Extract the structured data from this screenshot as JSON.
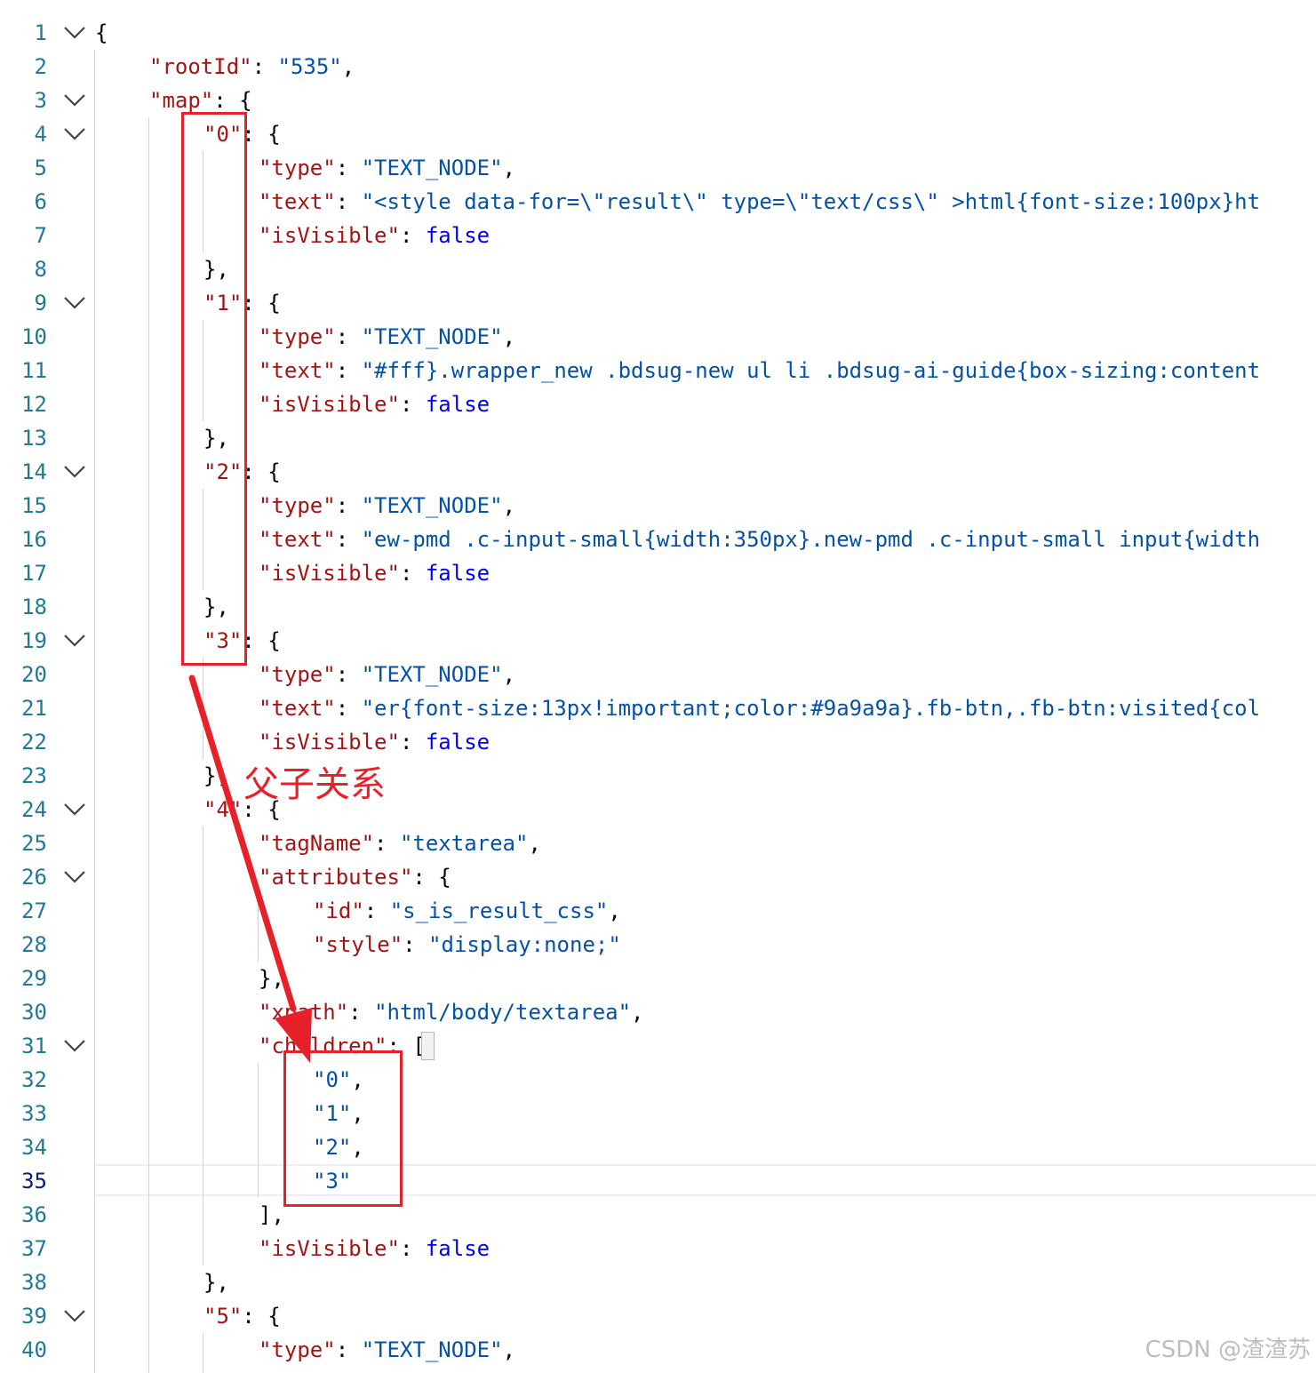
{
  "editor": {
    "active_line": 35,
    "lines": [
      {
        "n": "1",
        "fold": true,
        "indent": 0,
        "tokens": [
          [
            "p",
            "{"
          ]
        ]
      },
      {
        "n": "2",
        "fold": false,
        "indent": 1,
        "tokens": [
          [
            "k",
            "\"rootId\""
          ],
          [
            "p",
            ": "
          ],
          [
            "s",
            "\"535\""
          ],
          [
            "p",
            ","
          ]
        ]
      },
      {
        "n": "3",
        "fold": true,
        "indent": 1,
        "tokens": [
          [
            "k",
            "\"map\""
          ],
          [
            "p",
            ": {"
          ]
        ]
      },
      {
        "n": "4",
        "fold": true,
        "indent": 2,
        "tokens": [
          [
            "k",
            "\"0\""
          ],
          [
            "p",
            ": {"
          ]
        ]
      },
      {
        "n": "5",
        "fold": false,
        "indent": 3,
        "tokens": [
          [
            "k",
            "\"type\""
          ],
          [
            "p",
            ": "
          ],
          [
            "s",
            "\"TEXT_NODE\""
          ],
          [
            "p",
            ","
          ]
        ]
      },
      {
        "n": "6",
        "fold": false,
        "indent": 3,
        "tokens": [
          [
            "k",
            "\"text\""
          ],
          [
            "p",
            ": "
          ],
          [
            "s",
            "\"<style data-for=\\\"result\\\" type=\\\"text/css\\\" >html{font-size:100px}ht"
          ]
        ]
      },
      {
        "n": "7",
        "fold": false,
        "indent": 3,
        "tokens": [
          [
            "k",
            "\"isVisible\""
          ],
          [
            "p",
            ": "
          ],
          [
            "b",
            "false"
          ]
        ]
      },
      {
        "n": "8",
        "fold": false,
        "indent": 2,
        "tokens": [
          [
            "p",
            "},"
          ]
        ]
      },
      {
        "n": "9",
        "fold": true,
        "indent": 2,
        "tokens": [
          [
            "k",
            "\"1\""
          ],
          [
            "p",
            ": {"
          ]
        ]
      },
      {
        "n": "10",
        "fold": false,
        "indent": 3,
        "tokens": [
          [
            "k",
            "\"type\""
          ],
          [
            "p",
            ": "
          ],
          [
            "s",
            "\"TEXT_NODE\""
          ],
          [
            "p",
            ","
          ]
        ]
      },
      {
        "n": "11",
        "fold": false,
        "indent": 3,
        "tokens": [
          [
            "k",
            "\"text\""
          ],
          [
            "p",
            ": "
          ],
          [
            "s",
            "\"#fff}.wrapper_new .bdsug-new ul li .bdsug-ai-guide{box-sizing:content"
          ]
        ]
      },
      {
        "n": "12",
        "fold": false,
        "indent": 3,
        "tokens": [
          [
            "k",
            "\"isVisible\""
          ],
          [
            "p",
            ": "
          ],
          [
            "b",
            "false"
          ]
        ]
      },
      {
        "n": "13",
        "fold": false,
        "indent": 2,
        "tokens": [
          [
            "p",
            "},"
          ]
        ]
      },
      {
        "n": "14",
        "fold": true,
        "indent": 2,
        "tokens": [
          [
            "k",
            "\"2\""
          ],
          [
            "p",
            ": {"
          ]
        ]
      },
      {
        "n": "15",
        "fold": false,
        "indent": 3,
        "tokens": [
          [
            "k",
            "\"type\""
          ],
          [
            "p",
            ": "
          ],
          [
            "s",
            "\"TEXT_NODE\""
          ],
          [
            "p",
            ","
          ]
        ]
      },
      {
        "n": "16",
        "fold": false,
        "indent": 3,
        "tokens": [
          [
            "k",
            "\"text\""
          ],
          [
            "p",
            ": "
          ],
          [
            "s",
            "\"ew-pmd .c-input-small{width:350px}.new-pmd .c-input-small input{width"
          ]
        ]
      },
      {
        "n": "17",
        "fold": false,
        "indent": 3,
        "tokens": [
          [
            "k",
            "\"isVisible\""
          ],
          [
            "p",
            ": "
          ],
          [
            "b",
            "false"
          ]
        ]
      },
      {
        "n": "18",
        "fold": false,
        "indent": 2,
        "tokens": [
          [
            "p",
            "},"
          ]
        ]
      },
      {
        "n": "19",
        "fold": true,
        "indent": 2,
        "tokens": [
          [
            "k",
            "\"3\""
          ],
          [
            "p",
            ": {"
          ]
        ]
      },
      {
        "n": "20",
        "fold": false,
        "indent": 3,
        "tokens": [
          [
            "k",
            "\"type\""
          ],
          [
            "p",
            ": "
          ],
          [
            "s",
            "\"TEXT_NODE\""
          ],
          [
            "p",
            ","
          ]
        ]
      },
      {
        "n": "21",
        "fold": false,
        "indent": 3,
        "tokens": [
          [
            "k",
            "\"text\""
          ],
          [
            "p",
            ": "
          ],
          [
            "s",
            "\"er{font-size:13px!important;color:#9a9a9a}.fb-btn,.fb-btn:visited{col"
          ]
        ]
      },
      {
        "n": "22",
        "fold": false,
        "indent": 3,
        "tokens": [
          [
            "k",
            "\"isVisible\""
          ],
          [
            "p",
            ": "
          ],
          [
            "b",
            "false"
          ]
        ]
      },
      {
        "n": "23",
        "fold": false,
        "indent": 2,
        "tokens": [
          [
            "p",
            "},"
          ]
        ]
      },
      {
        "n": "24",
        "fold": true,
        "indent": 2,
        "tokens": [
          [
            "k",
            "\"4\""
          ],
          [
            "p",
            ": {"
          ]
        ]
      },
      {
        "n": "25",
        "fold": false,
        "indent": 3,
        "tokens": [
          [
            "k",
            "\"tagName\""
          ],
          [
            "p",
            ": "
          ],
          [
            "s",
            "\"textarea\""
          ],
          [
            "p",
            ","
          ]
        ]
      },
      {
        "n": "26",
        "fold": true,
        "indent": 3,
        "tokens": [
          [
            "k",
            "\"attributes\""
          ],
          [
            "p",
            ": {"
          ]
        ]
      },
      {
        "n": "27",
        "fold": false,
        "indent": 4,
        "tokens": [
          [
            "k",
            "\"id\""
          ],
          [
            "p",
            ": "
          ],
          [
            "s",
            "\"s_is_result_css\""
          ],
          [
            "p",
            ","
          ]
        ]
      },
      {
        "n": "28",
        "fold": false,
        "indent": 4,
        "tokens": [
          [
            "k",
            "\"style\""
          ],
          [
            "p",
            ": "
          ],
          [
            "s",
            "\"display:none;\""
          ]
        ]
      },
      {
        "n": "29",
        "fold": false,
        "indent": 3,
        "tokens": [
          [
            "p",
            "},"
          ]
        ]
      },
      {
        "n": "30",
        "fold": false,
        "indent": 3,
        "tokens": [
          [
            "k",
            "\"xpath\""
          ],
          [
            "p",
            ": "
          ],
          [
            "s",
            "\"html/body/textarea\""
          ],
          [
            "p",
            ","
          ]
        ]
      },
      {
        "n": "31",
        "fold": true,
        "indent": 3,
        "tokens": [
          [
            "k",
            "\"children\""
          ],
          [
            "p",
            ": ["
          ]
        ]
      },
      {
        "n": "32",
        "fold": false,
        "indent": 4,
        "tokens": [
          [
            "s",
            "\"0\""
          ],
          [
            "p",
            ","
          ]
        ]
      },
      {
        "n": "33",
        "fold": false,
        "indent": 4,
        "tokens": [
          [
            "s",
            "\"1\""
          ],
          [
            "p",
            ","
          ]
        ]
      },
      {
        "n": "34",
        "fold": false,
        "indent": 4,
        "tokens": [
          [
            "s",
            "\"2\""
          ],
          [
            "p",
            ","
          ]
        ]
      },
      {
        "n": "35",
        "fold": false,
        "indent": 4,
        "tokens": [
          [
            "s",
            "\"3\""
          ]
        ]
      },
      {
        "n": "36",
        "fold": false,
        "indent": 3,
        "tokens": [
          [
            "p",
            "],"
          ]
        ]
      },
      {
        "n": "37",
        "fold": false,
        "indent": 3,
        "tokens": [
          [
            "k",
            "\"isVisible\""
          ],
          [
            "p",
            ": "
          ],
          [
            "b",
            "false"
          ]
        ]
      },
      {
        "n": "38",
        "fold": false,
        "indent": 2,
        "tokens": [
          [
            "p",
            "},"
          ]
        ]
      },
      {
        "n": "39",
        "fold": true,
        "indent": 2,
        "tokens": [
          [
            "k",
            "\"5\""
          ],
          [
            "p",
            ": {"
          ]
        ]
      },
      {
        "n": "40",
        "fold": false,
        "indent": 3,
        "tokens": [
          [
            "k",
            "\"type\""
          ],
          [
            "p",
            ": "
          ],
          [
            "s",
            "\"TEXT_NODE\""
          ],
          [
            "p",
            ","
          ]
        ]
      }
    ]
  },
  "annotation": {
    "label": "父子关系",
    "color": "#e8202a"
  },
  "watermark": "CSDN @渣渣苏",
  "colors": {
    "line_number": "#237893",
    "key": "#a31515",
    "string": "#0451a5",
    "boolean": "#0000ff"
  },
  "icons": {
    "fold": "chevron-down-icon",
    "arrow": "red-arrow-icon"
  }
}
